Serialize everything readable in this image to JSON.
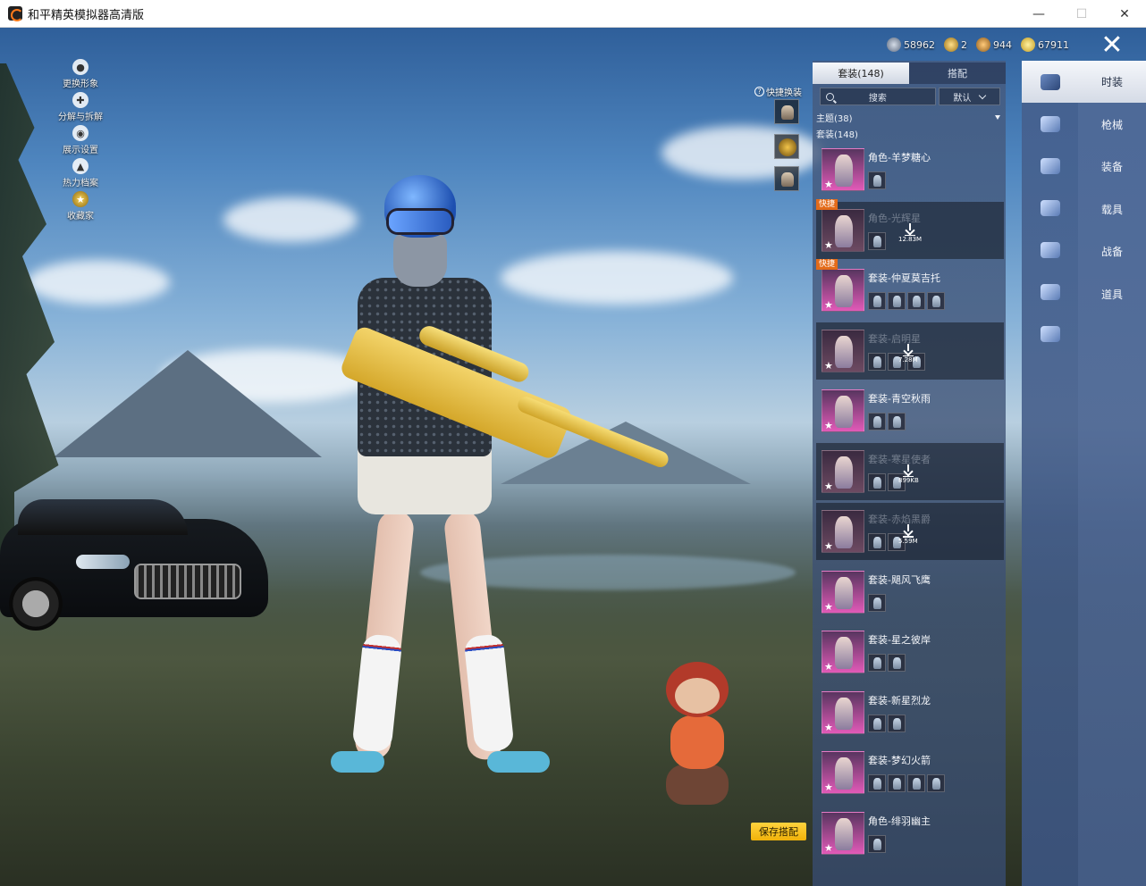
{
  "window": {
    "title": "和平精英模拟器高清版",
    "minimize": "—",
    "maximize": "☐",
    "close": "✕"
  },
  "resources": [
    {
      "icon": "silver-coin-icon",
      "value": "58962"
    },
    {
      "icon": "gold-badge-icon",
      "value": "2"
    },
    {
      "icon": "bronze-coin-icon",
      "value": "944"
    },
    {
      "icon": "gold-coin-icon",
      "value": "67911"
    }
  ],
  "close_button": "✕",
  "left_menu": [
    {
      "label": "更换形象",
      "icon": "person-icon",
      "glyph": "●"
    },
    {
      "label": "分解与拆解",
      "icon": "puzzle-icon",
      "glyph": "✚"
    },
    {
      "label": "展示设置",
      "icon": "eye-icon",
      "glyph": "◉"
    },
    {
      "label": "热力档案",
      "icon": "flame-icon",
      "glyph": "▲"
    },
    {
      "label": "收藏家",
      "icon": "collector-badge-icon",
      "glyph": "★"
    }
  ],
  "quick_swap": {
    "label": "快捷换装",
    "help": "?"
  },
  "save_button": "保存搭配",
  "panel": {
    "tabs": [
      "套装(148)",
      "搭配"
    ],
    "search_placeholder": "搜索",
    "sort": "默认",
    "theme": "主题(38)",
    "suit_count": "套装(148)"
  },
  "items": [
    {
      "name": "角色-羊梦糖心",
      "dim": false,
      "quick": false,
      "subs": 1,
      "download": ""
    },
    {
      "name": "角色-光辉星",
      "dim": true,
      "quick": true,
      "subs": 1,
      "download": "12.83M"
    },
    {
      "name": "套装-仲夏莫吉托",
      "dim": false,
      "quick": true,
      "subs": 4,
      "download": ""
    },
    {
      "name": "套装-启明星",
      "dim": true,
      "quick": false,
      "subs": 3,
      "download": "7.28M"
    },
    {
      "name": "套装-青空秋雨",
      "dim": false,
      "quick": false,
      "subs": 2,
      "download": ""
    },
    {
      "name": "套装-寒星使者",
      "dim": true,
      "quick": false,
      "subs": 2,
      "download": "899KB"
    },
    {
      "name": "套装-赤焰黑爵",
      "dim": true,
      "quick": false,
      "subs": 2,
      "download": "5.59M"
    },
    {
      "name": "套装-飓风飞鹰",
      "dim": false,
      "quick": false,
      "subs": 1,
      "download": ""
    },
    {
      "name": "套装-星之彼岸",
      "dim": false,
      "quick": false,
      "subs": 2,
      "download": ""
    },
    {
      "name": "套装-新星烈龙",
      "dim": false,
      "quick": false,
      "subs": 2,
      "download": ""
    },
    {
      "name": "套装-梦幻火箭",
      "dim": false,
      "quick": false,
      "subs": 4,
      "download": ""
    },
    {
      "name": "角色-绯羽幽主",
      "dim": false,
      "quick": false,
      "subs": 1,
      "download": ""
    }
  ],
  "quick_label": "快捷",
  "icon_column": [
    {
      "icon": "outfit-icon",
      "active": true
    },
    {
      "icon": "parachute-icon",
      "active": false
    },
    {
      "icon": "backpack-icon",
      "active": false
    },
    {
      "icon": "helmet-icon",
      "active": false
    },
    {
      "icon": "vehicle-icon",
      "active": false
    },
    {
      "icon": "pet-icon",
      "active": false
    },
    {
      "icon": "emote-icon",
      "active": false
    }
  ],
  "categories": [
    {
      "label": "时装",
      "active": true
    },
    {
      "label": "枪械",
      "active": false
    },
    {
      "label": "装备",
      "active": false
    },
    {
      "label": "载具",
      "active": false
    },
    {
      "label": "战备",
      "active": false
    },
    {
      "label": "道具",
      "active": false
    }
  ]
}
